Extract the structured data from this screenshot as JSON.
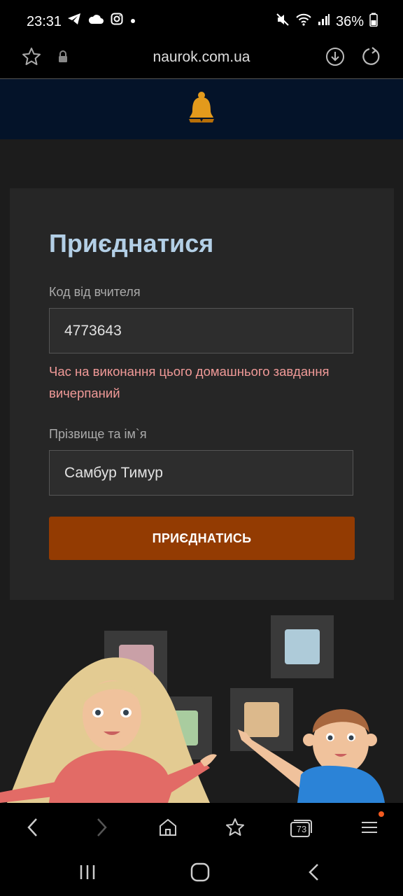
{
  "status_bar": {
    "time": "23:31",
    "battery": "36%"
  },
  "browser": {
    "url": "naurok.com.ua",
    "tabs_count": "73"
  },
  "form": {
    "title": "Приєднатися",
    "code_label": "Код від вчителя",
    "code_value": "4773643",
    "error_message": "Час на виконання цього домашнього завдання вичерпаний",
    "name_label": "Прізвище та ім`я",
    "name_value": "Самбур Тимур",
    "submit_label": "ПРИЄДНАТИСЬ"
  },
  "colors": {
    "header_bg": "#041329",
    "button": "#933b02",
    "title": "#b3cfe6",
    "error": "#f19a98",
    "logo": "#e39a1c"
  }
}
